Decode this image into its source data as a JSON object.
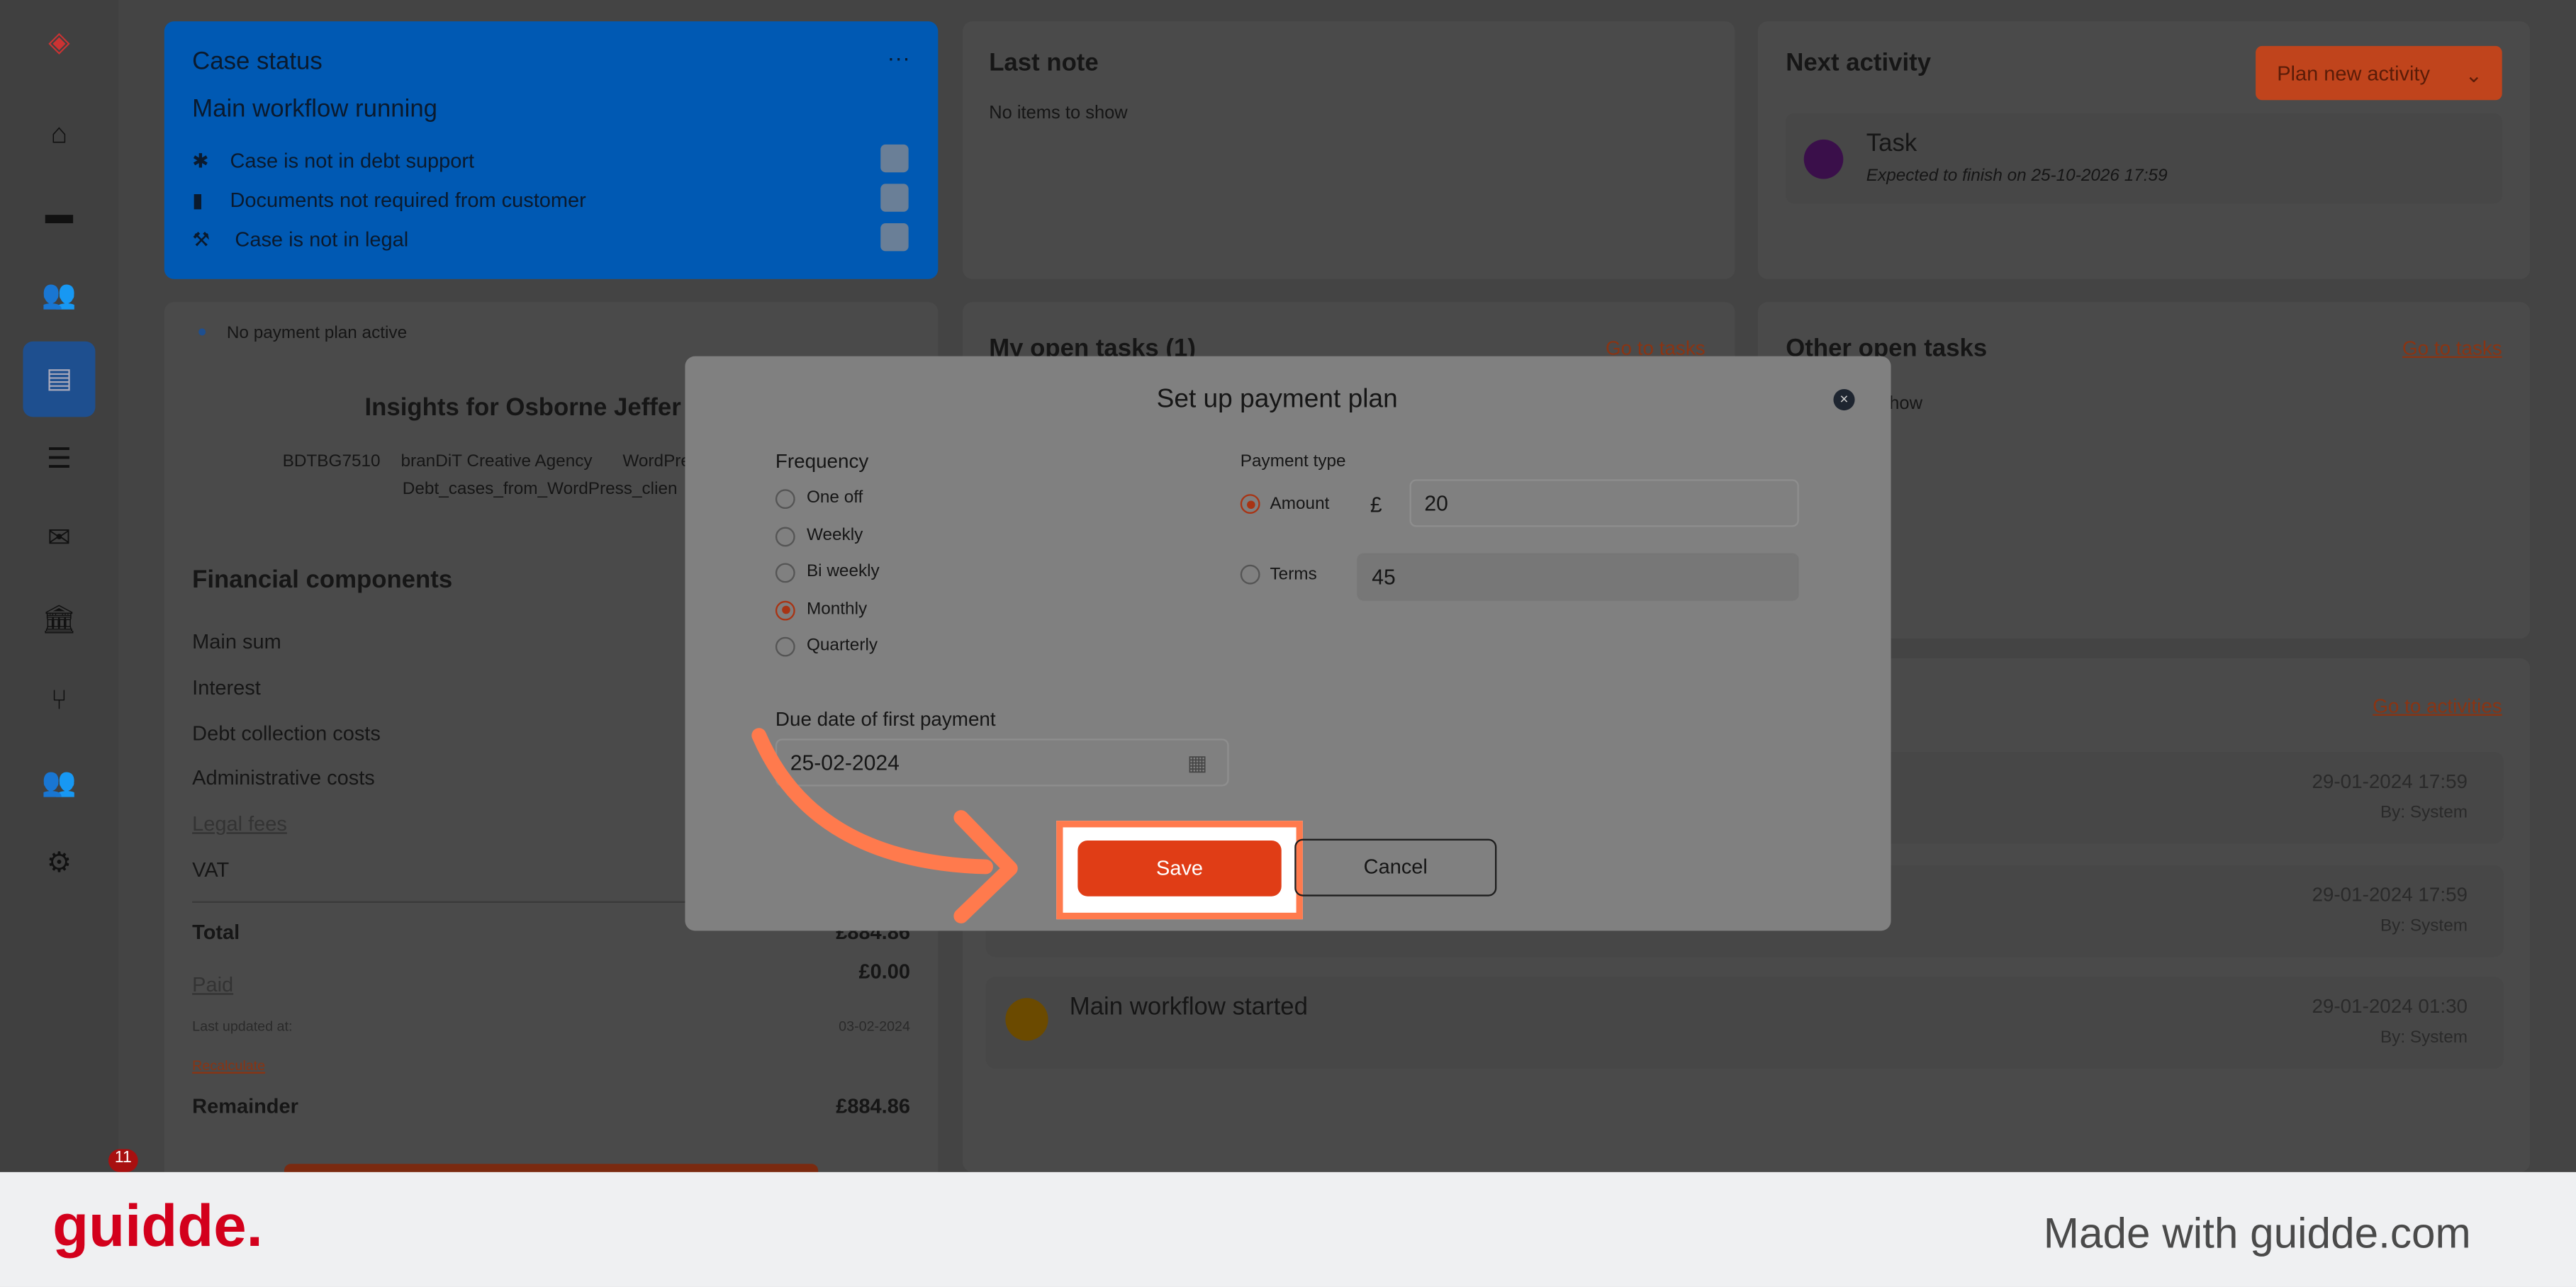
{
  "sidebar": {
    "items": [
      {
        "icon": "logo-icon"
      },
      {
        "icon": "home-icon"
      },
      {
        "icon": "ticket-icon"
      },
      {
        "icon": "users-icon"
      },
      {
        "icon": "id-card-icon",
        "active": true
      },
      {
        "icon": "database-icon"
      },
      {
        "icon": "mail-icon"
      },
      {
        "icon": "bank-icon"
      },
      {
        "icon": "branch-icon"
      },
      {
        "icon": "team-icon"
      },
      {
        "icon": "gear-icon"
      }
    ],
    "notification_count": "11"
  },
  "case_status": {
    "title": "Case status",
    "menu": "···",
    "workflow": "Main workflow running",
    "items": [
      "Case is not in debt support",
      "Documents not required from customer",
      "Case is not in legal"
    ]
  },
  "last_note": {
    "title": "Last note",
    "empty": "No items to show"
  },
  "next_activity": {
    "title": "Next activity",
    "button": "Plan new activity",
    "task_title": "Task",
    "task_sub": "Expected to finish on 25-10-2026 17:59"
  },
  "insights": {
    "notice": "No payment plan active",
    "title": "Insights for Osborne Jeffer",
    "meta1": "BDTBG7510",
    "meta2": "branDiT Creative Agency",
    "meta3": "WordPre",
    "meta4": "Debt_cases_from_WordPress_clien"
  },
  "financial": {
    "title": "Financial components",
    "rows": [
      "Main sum",
      "Interest",
      "Debt collection costs",
      "Administrative costs",
      "Legal fees",
      "VAT"
    ],
    "total_label": "Total",
    "total": "£884.86",
    "paid_label": "Paid",
    "paid": "£0.00",
    "updated_label": "Last updated at:",
    "updated": "03-02-2024",
    "recalc": "Recalculate",
    "remainder_label": "Remainder",
    "remainder": "£884.86"
  },
  "my_tasks": {
    "title": "My open tasks (1)",
    "link": "Go to tasks"
  },
  "other_tasks": {
    "title": "Other open tasks",
    "link": "Go to tasks",
    "empty": "how"
  },
  "activities": {
    "link": "Go to activities",
    "items": [
      {
        "title": "",
        "date": "29-01-2024 17:59",
        "by": "By: System"
      },
      {
        "title": "",
        "date": "29-01-2024 17:59",
        "by": "By: System"
      },
      {
        "title": "Main workflow started",
        "date": "29-01-2024 01:30",
        "by": "By: System"
      }
    ]
  },
  "modal": {
    "title": "Set up payment plan",
    "frequency_label": "Frequency",
    "frequency_options": [
      "One off",
      "Weekly",
      "Bi weekly",
      "Monthly",
      "Quarterly"
    ],
    "frequency_selected": "Monthly",
    "payment_type_label": "Payment type",
    "amount_label": "Amount",
    "currency": "£",
    "amount_value": "20",
    "terms_label": "Terms",
    "terms_value": "45",
    "payment_type_selected": "Amount",
    "due_label": "Due date of first payment",
    "due_value": "25-02-2024",
    "save": "Save",
    "cancel": "Cancel"
  },
  "footer": {
    "brand": "guidde.",
    "tagline": "Made with guidde.com"
  },
  "colors": {
    "accent": "#e03d16",
    "highlight": "#ff7a4d",
    "case_blue": "#0059b3",
    "brand": "#d3001c"
  }
}
